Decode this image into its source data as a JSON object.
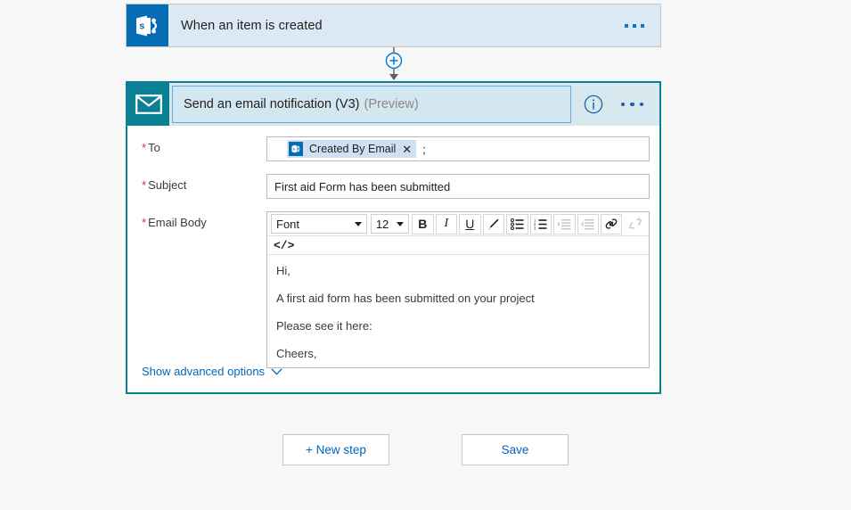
{
  "trigger": {
    "title": "When an item is created",
    "icon": "sharepoint-icon",
    "menu_label": "..."
  },
  "connector": {
    "add_label": "+",
    "icon": "add-step-icon"
  },
  "action": {
    "title": "Send an email notification (V3)",
    "preview_tag": "(Preview)",
    "icon": "email-icon",
    "info_label": "i",
    "menu_label": "...",
    "fields": {
      "to": {
        "label": "To",
        "required_marker": "*",
        "token_label": "Created By Email",
        "token_remove": "✕",
        "separator": ";"
      },
      "subject": {
        "label": "Subject",
        "required_marker": "*",
        "value": "First aid Form has been submitted"
      },
      "email_body": {
        "label": "Email Body",
        "required_marker": "*",
        "toolbar": {
          "font_name": "Font",
          "font_size": "12",
          "bold": "B",
          "italic": "I",
          "underline": "U",
          "text_color": "text-color-icon",
          "bulleted_list": "bulleted-list-icon",
          "numbered_list": "numbered-list-icon",
          "indent": "indent-icon",
          "outdent": "outdent-icon",
          "link": "link-icon",
          "unlink": "unlink-icon",
          "code_view": "</>"
        },
        "content": [
          "Hi,",
          "A first aid form has been submitted on your project",
          "Please see it here:",
          "Cheers,"
        ]
      }
    },
    "advanced_options": {
      "label": "Show advanced options",
      "icon": "chevron-down-icon"
    }
  },
  "footer": {
    "new_step_label": "+ New step",
    "save_label": "Save"
  },
  "colors": {
    "sharepoint_blue": "#036cb4",
    "email_teal": "#0b7f93",
    "trigger_bg": "#dce9f5",
    "action_header_bg": "#d7e9ee",
    "link_blue": "#0066bb",
    "required_red": "#d13438",
    "canvas_bg": "#f7f7f7"
  }
}
